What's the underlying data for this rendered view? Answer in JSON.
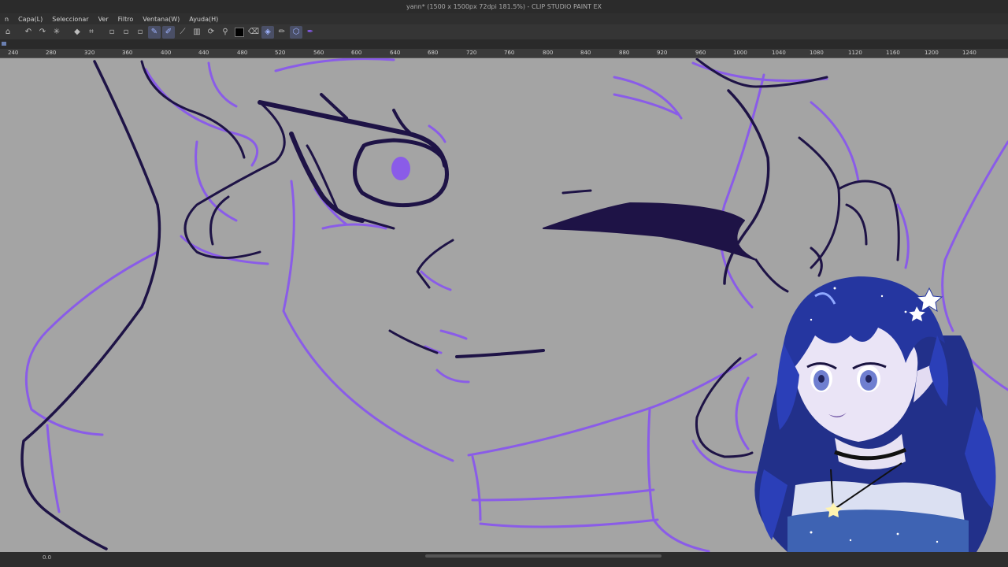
{
  "window": {
    "title": "yann* (1500 x 1500px 72dpi 181.5%) - CLIP STUDIO PAINT EX"
  },
  "menu": {
    "items": [
      "n",
      "Capa(L)",
      "Seleccionar",
      "Ver",
      "Filtro",
      "Ventana(W)",
      "Ayuda(H)"
    ]
  },
  "toolbar": {
    "icons": [
      "undo-icon",
      "redo-icon",
      "transform-icon",
      "fill-icon",
      "crop-icon",
      "pen-icon",
      "brush-icon",
      "ruler-icon",
      "lasso-icon",
      "eyedropper-icon",
      "color-swatch",
      "eraser-icon",
      "select-icon",
      "pencil-icon",
      "layer-icon",
      "purple-pen-icon"
    ]
  },
  "ruler": {
    "labels": [
      "240",
      "280",
      "320",
      "360",
      "400",
      "440",
      "480",
      "520",
      "560",
      "600",
      "640",
      "680",
      "720",
      "760",
      "800",
      "840",
      "880",
      "920",
      "960",
      "1000",
      "1040",
      "1080",
      "1120",
      "1160",
      "1200",
      "1240"
    ]
  },
  "status": {
    "zoom": "0.0"
  },
  "colors": {
    "lineart": "#1e1346",
    "sketch": "#8a5ce8",
    "canvas": "#a4a4a4",
    "accent_blue": "#2c3fb0"
  }
}
